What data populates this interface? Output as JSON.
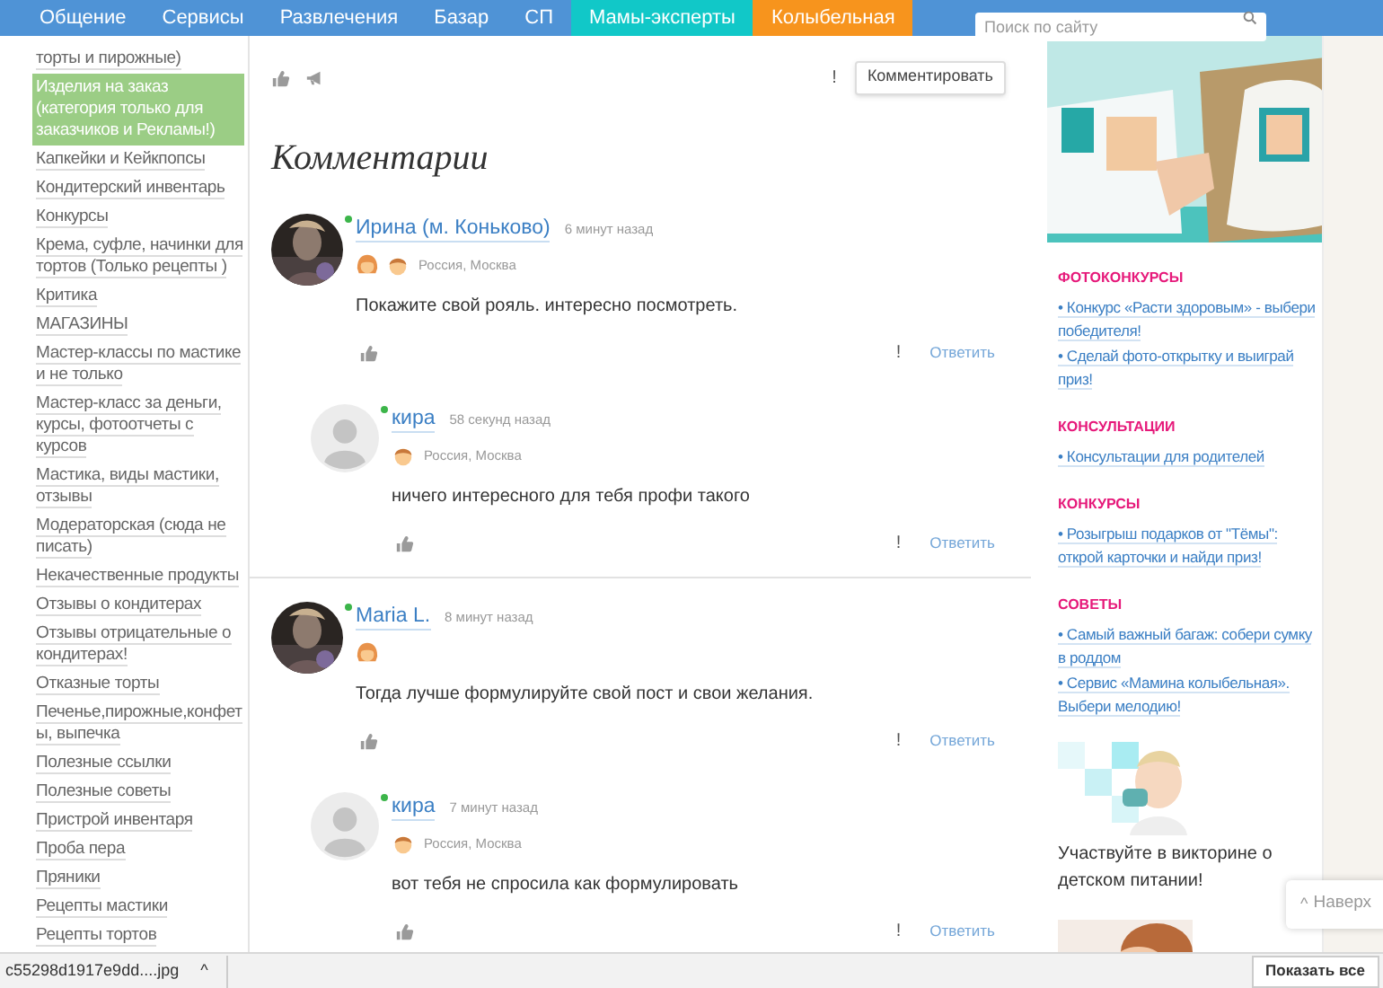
{
  "nav": {
    "items": [
      {
        "label": "Общение",
        "kind": "plain"
      },
      {
        "label": "Сервисы",
        "kind": "plain"
      },
      {
        "label": "Развлечения",
        "kind": "plain"
      },
      {
        "label": "Базар",
        "kind": "plain"
      },
      {
        "label": "СП",
        "kind": "plain"
      },
      {
        "label": "Мамы-эксперты",
        "kind": "teal"
      },
      {
        "label": "Колыбельная",
        "kind": "orange"
      }
    ]
  },
  "search": {
    "placeholder": "Поиск по сайту"
  },
  "sidebar": {
    "items": [
      {
        "label": "торты и пирожные)",
        "selected": false
      },
      {
        "label": "Изделия на заказ (категория только для заказчиков и Рекламы!)",
        "selected": true
      },
      {
        "label": "Капкейки и Кейкпопсы",
        "selected": false
      },
      {
        "label": "Кондитерский инвентарь",
        "selected": false
      },
      {
        "label": "Конкурсы",
        "selected": false
      },
      {
        "label": "Крема, суфле, начинки для тортов (Только рецепты )",
        "selected": false
      },
      {
        "label": "Критика",
        "selected": false
      },
      {
        "label": "МАГАЗИНЫ",
        "selected": false
      },
      {
        "label": "Мастер-классы по мастике и не только",
        "selected": false
      },
      {
        "label": "Мастер-класс за деньги, курсы, фотоотчеты с курсов",
        "selected": false
      },
      {
        "label": "Мастика, виды мастики, отзывы",
        "selected": false
      },
      {
        "label": "Модераторская (сюда не писать)",
        "selected": false
      },
      {
        "label": "Некачественные продукты",
        "selected": false
      },
      {
        "label": "Отзывы о кондитерах",
        "selected": false
      },
      {
        "label": "Отзывы отрицательные о кондитерах!",
        "selected": false
      },
      {
        "label": "Отказные торты",
        "selected": false
      },
      {
        "label": "Печенье,пирожные,конфеты, выпечка",
        "selected": false
      },
      {
        "label": "Полезные ссылки",
        "selected": false
      },
      {
        "label": "Полезные советы",
        "selected": false
      },
      {
        "label": "Пристрой инвентаря",
        "selected": false
      },
      {
        "label": "Проба пера",
        "selected": false
      },
      {
        "label": "Пряники",
        "selected": false
      },
      {
        "label": "Рецепты мастики",
        "selected": false
      },
      {
        "label": "Рецепты тортов",
        "selected": false
      }
    ]
  },
  "toolbar": {
    "report": "!",
    "comment_button": "Комментировать"
  },
  "heading": "Комментарии",
  "comments": [
    {
      "avatar": {
        "kind": "picture"
      },
      "online": true,
      "author": "Ирина (м. Коньково)",
      "time": "6 минут назад",
      "badges": [
        {
          "kind": "girl"
        },
        {
          "kind": "boy"
        }
      ],
      "location": "Россия, Москва",
      "text": "Покажите свой рояль. интересно посмотреть.",
      "report": "!",
      "reply": "Ответить",
      "replies": [
        {
          "avatar": {
            "kind": "placeholder"
          },
          "online": true,
          "author": "кира",
          "time": "58 секунд назад",
          "badges": [
            {
              "kind": "boy"
            }
          ],
          "location": "Россия, Москва",
          "text": "ничего интересного для тебя профи такого",
          "report": "!",
          "reply": "Ответить"
        }
      ]
    },
    {
      "avatar": {
        "kind": "picture"
      },
      "online": true,
      "author": "Maria L.",
      "time": "8 минут назад",
      "badges": [
        {
          "kind": "girl"
        }
      ],
      "text": "Тогда лучше формулируйте свой пост и свои желания.",
      "report": "!",
      "reply": "Ответить",
      "replies": [
        {
          "avatar": {
            "kind": "placeholder"
          },
          "online": true,
          "author": "кира",
          "time": "7 минут назад",
          "badges": [
            {
              "kind": "boy"
            }
          ],
          "location": "Россия, Москва",
          "text": "вот тебя не спросила как формулировать",
          "report": "!",
          "reply": "Ответить"
        }
      ]
    }
  ],
  "right": {
    "sections": [
      {
        "title": "ФОТОКОНКУРСЫ",
        "links": [
          "• Конкурс «Расти здоровым» - выбери победителя!",
          "• Сделай фото-открытку и выиграй приз!"
        ]
      },
      {
        "title": "КОНСУЛЬТАЦИИ",
        "links": [
          "• Консультации для родителей"
        ]
      },
      {
        "title": "КОНКУРСЫ",
        "links": [
          "• Розыгрыш подарков от \"Тёмы\": открой карточки и найди приз!"
        ]
      },
      {
        "title": "СОВЕТЫ",
        "links": [
          "• Самый важный багаж: собери сумку в роддом",
          "• Сервис «Мамина колыбельная». Выбери мелодию!"
        ]
      }
    ],
    "promo": "Участвуйте в викторине о детском питании!"
  },
  "back_to_top": {
    "caret": "^",
    "label": "Наверх"
  },
  "downloads": {
    "file": "c55298d1917e9dd....jpg",
    "caret": "^",
    "show_all": "Показать все"
  }
}
